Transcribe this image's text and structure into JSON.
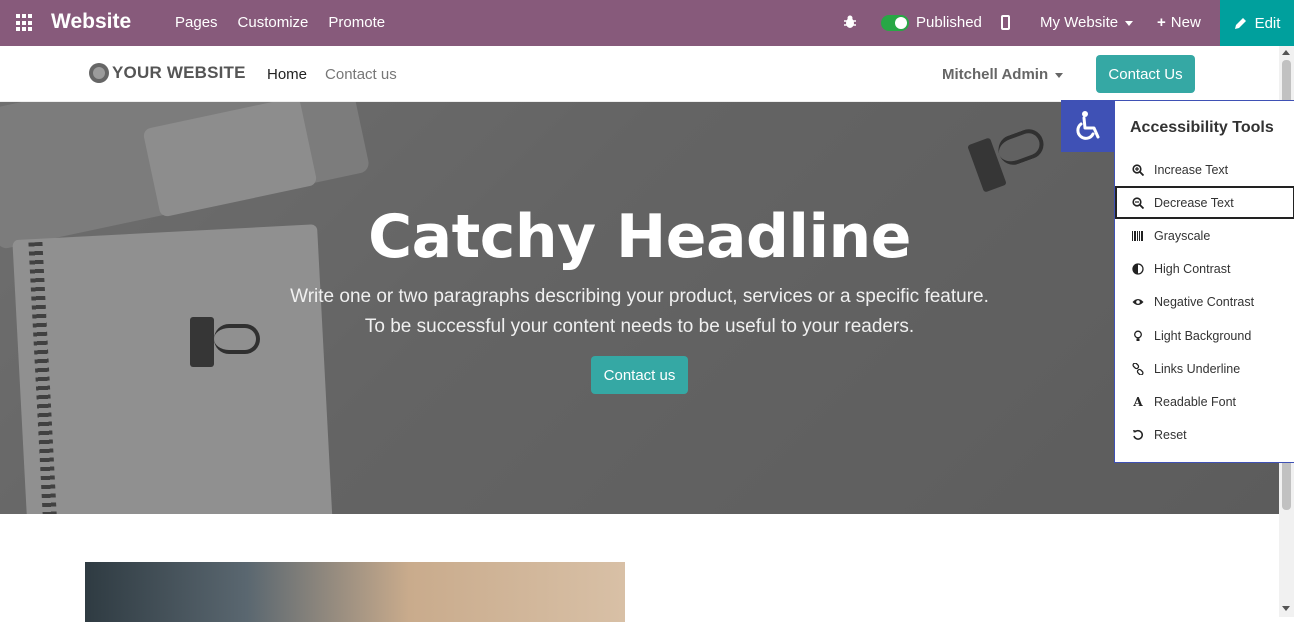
{
  "admin": {
    "title": "Website",
    "menu": [
      "Pages",
      "Customize",
      "Promote"
    ],
    "published_label": "Published",
    "website_selector": "My Website",
    "new_label": "New",
    "edit_label": "Edit"
  },
  "site": {
    "logo_text": "YOUR WEBSITE",
    "nav": [
      "Home",
      "Contact us"
    ],
    "user": "Mitchell Admin",
    "contact_button": "Contact Us"
  },
  "hero": {
    "headline": "Catchy Headline",
    "line1": "Write one or two paragraphs describing your product, services or a specific feature.",
    "line2": "To be successful your content needs to be useful to your readers.",
    "button": "Contact us"
  },
  "accessibility": {
    "title": "Accessibility Tools",
    "items": [
      {
        "label": "Increase Text",
        "icon": "zoom-in-icon"
      },
      {
        "label": "Decrease Text",
        "icon": "zoom-out-icon"
      },
      {
        "label": "Grayscale",
        "icon": "barcode-icon"
      },
      {
        "label": "High Contrast",
        "icon": "contrast-icon"
      },
      {
        "label": "Negative Contrast",
        "icon": "eye-icon"
      },
      {
        "label": "Light Background",
        "icon": "lightbulb-icon"
      },
      {
        "label": "Links Underline",
        "icon": "link-icon"
      },
      {
        "label": "Readable Font",
        "icon": "font-icon"
      },
      {
        "label": "Reset",
        "icon": "reset-icon"
      }
    ],
    "active_item": "Decrease Text"
  },
  "colors": {
    "admin_bar": "#875a7b",
    "edit_button": "#00a09d",
    "primary_button": "#35a8a4",
    "accessibility_accent": "#3f51b5"
  }
}
